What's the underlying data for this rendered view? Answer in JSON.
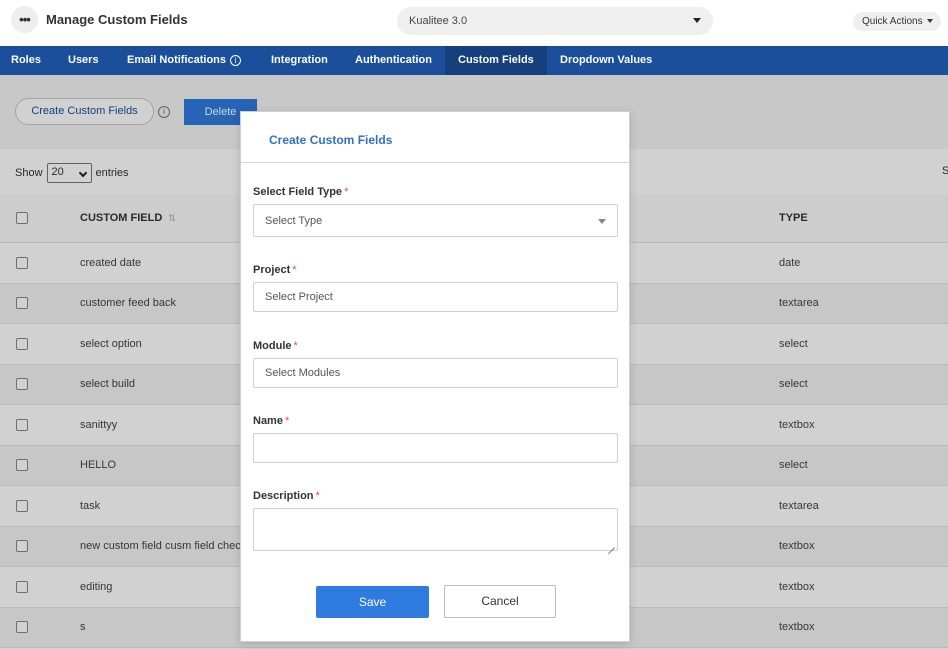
{
  "header": {
    "menu_icon": "ellipsis-icon",
    "title": "Manage Custom Fields",
    "project_selector": {
      "selected": "Kualitee 3.0"
    },
    "quick_actions_label": "Quick Actions"
  },
  "nav": {
    "tabs": [
      {
        "label": "Roles",
        "active": false
      },
      {
        "label": "Users",
        "active": false
      },
      {
        "label": "Email Notifications",
        "active": false,
        "info_icon": "i"
      },
      {
        "label": "Integration",
        "active": false
      },
      {
        "label": "Authentication",
        "active": false
      },
      {
        "label": "Custom Fields",
        "active": true
      },
      {
        "label": "Dropdown Values",
        "active": false
      }
    ],
    "colors": {
      "bar": "#1b4e9b",
      "active": "#153f7e"
    }
  },
  "toolbar": {
    "create_label": "Create Custom Fields",
    "info_icon": "i",
    "delete_label": "Delete"
  },
  "list": {
    "show_label": "Show",
    "page_size": "20",
    "entries_label": "entries",
    "search_fragment": "S",
    "columns": {
      "name": "CUSTOM FIELD",
      "type": "TYPE"
    },
    "rows": [
      {
        "name": "created date",
        "type": "date"
      },
      {
        "name": "customer feed back",
        "type": "textarea"
      },
      {
        "name": "select option",
        "type": "select"
      },
      {
        "name": "select build",
        "type": "select"
      },
      {
        "name": "sanittyy",
        "type": "textbox"
      },
      {
        "name": "HELLO",
        "type": "select"
      },
      {
        "name": "task",
        "type": "textarea"
      },
      {
        "name": "new custom field cusm field check n",
        "type": "textbox"
      },
      {
        "name": "editing",
        "type": "textbox"
      },
      {
        "name": "s",
        "type": "textbox"
      }
    ]
  },
  "modal": {
    "title": "Create Custom Fields",
    "required_mark": "*",
    "field_type": {
      "label": "Select Field Type",
      "value": "Select Type"
    },
    "project": {
      "label": "Project",
      "value": "Select Project"
    },
    "module": {
      "label": "Module",
      "value": "Select Modules"
    },
    "name": {
      "label": "Name",
      "value": ""
    },
    "description": {
      "label": "Description",
      "value": ""
    },
    "save_label": "Save",
    "cancel_label": "Cancel"
  },
  "colors": {
    "accent": "#2f7be0",
    "title_blue": "#2f6fc4",
    "required": "#e0533a"
  }
}
